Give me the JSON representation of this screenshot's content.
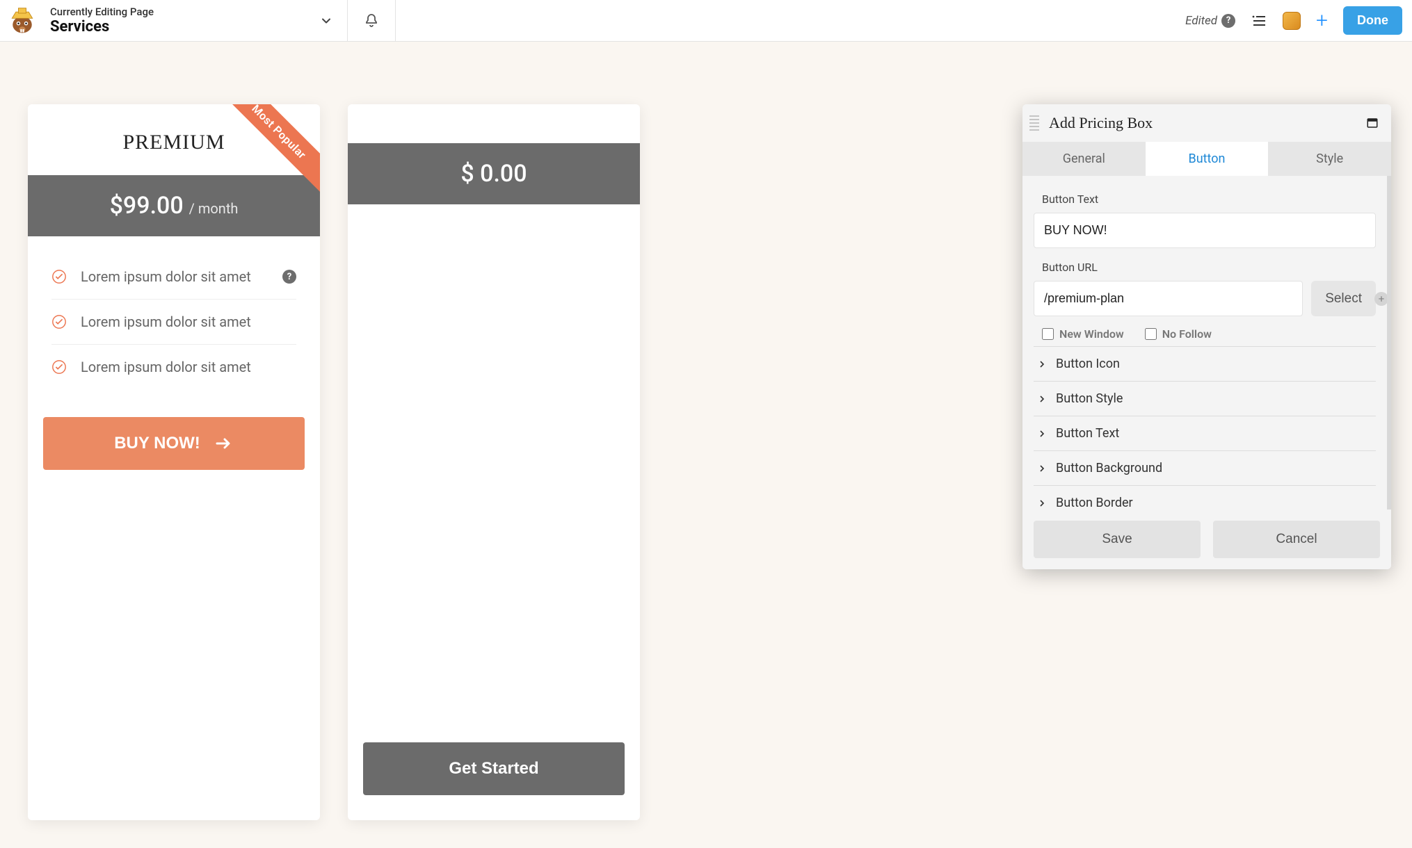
{
  "topbar": {
    "editing_label": "Currently Editing Page",
    "page_name": "Services",
    "status": "Edited",
    "done": "Done"
  },
  "cards": {
    "premium": {
      "ribbon": "Most Popular",
      "title": "PREMIUM",
      "price": "$99.00",
      "period": "/ month",
      "features": [
        "Lorem ipsum dolor sit amet",
        "Lorem ipsum dolor sit amet",
        "Lorem ipsum dolor sit amet"
      ],
      "cta": "BUY NOW!"
    },
    "basic": {
      "price": "$ 0.00",
      "cta": "Get Started"
    }
  },
  "panel": {
    "title": "Add Pricing Box",
    "tabs": {
      "general": "General",
      "button": "Button",
      "style": "Style"
    },
    "fields": {
      "button_text_label": "Button Text",
      "button_text_value": "BUY NOW!",
      "button_url_label": "Button URL",
      "button_url_value": "/premium-plan",
      "select": "Select",
      "new_window": "New Window",
      "no_follow": "No Follow"
    },
    "accordion": [
      "Button Icon",
      "Button Style",
      "Button Text",
      "Button Background",
      "Button Border"
    ],
    "save": "Save",
    "cancel": "Cancel"
  }
}
